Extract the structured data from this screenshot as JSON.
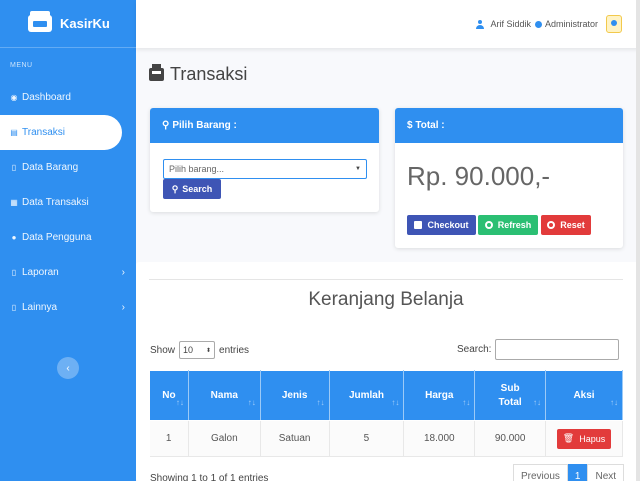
{
  "app": {
    "brand": "KasirKu"
  },
  "sidebar": {
    "heading": "MENU",
    "items": [
      {
        "label": "Dashboard",
        "icon": "gauge-icon"
      },
      {
        "label": "Transaksi",
        "icon": "cash-register-icon"
      },
      {
        "label": "Data Barang",
        "icon": "file-icon"
      },
      {
        "label": "Data Transaksi",
        "icon": "table-icon"
      },
      {
        "label": "Data Pengguna",
        "icon": "users-icon"
      },
      {
        "label": "Laporan",
        "icon": "file-icon"
      },
      {
        "label": "Lainnya",
        "icon": "file-icon"
      }
    ],
    "toggle": "‹"
  },
  "topbar": {
    "user_name": "Arif Siddik",
    "role": "Administrator"
  },
  "page": {
    "title": "Transaksi"
  },
  "pilih": {
    "header": "Pilih Barang :",
    "placeholder": "Pilih barang...",
    "search_label": "Search"
  },
  "total": {
    "header": "$ Total :",
    "amount": "Rp. 90.000,-",
    "checkout_label": "Checkout",
    "refresh_label": "Refresh",
    "reset_label": "Reset"
  },
  "cart": {
    "title": "Keranjang Belanja",
    "show_label": "Show",
    "entries_value": "10",
    "entries_label": "entries",
    "search_label": "Search:",
    "columns": [
      "No",
      "Nama",
      "Jenis",
      "Jumlah",
      "Harga",
      "Sub Total",
      "Aksi"
    ],
    "rows": [
      {
        "no": "1",
        "nama": "Galon",
        "jenis": "Satuan",
        "jumlah": "5",
        "harga": "18.000",
        "subtotal": "90.000",
        "aksi": "Hapus"
      }
    ],
    "showing": "Showing 1 to 1 of 1 entries",
    "pager": {
      "previous": "Previous",
      "current": "1",
      "next": "Next"
    }
  },
  "colors": {
    "primary": "#2f8ff0",
    "indigo": "#3e55b5",
    "success": "#2bbf73",
    "danger": "#e23b3b"
  }
}
